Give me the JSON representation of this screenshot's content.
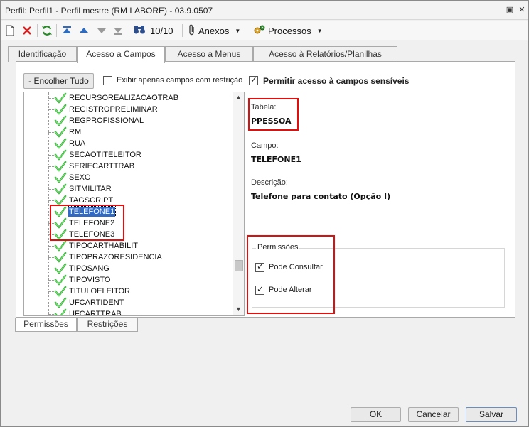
{
  "window": {
    "title": "Perfil: Perfil1 - Perfil mestre (RM LABORE) - 03.9.0507",
    "restore_glyph": "▣",
    "close_glyph": "✕"
  },
  "toolbar": {
    "record_counter": "10/10",
    "anexos_label": "Anexos",
    "processos_label": "Processos",
    "icons": [
      "new-doc-icon",
      "delete-icon",
      "refresh-icon",
      "first-record-icon",
      "previous-record-icon",
      "next-record-icon",
      "last-record-icon",
      "binoculars-icon",
      "paperclip-icon",
      "gears-icon"
    ]
  },
  "tabs": [
    {
      "label": "Identificação",
      "active": false
    },
    {
      "label": "Acesso a Campos",
      "active": true
    },
    {
      "label": "Acesso a Menus",
      "active": false
    },
    {
      "label": "Acesso à Relatórios/Planilhas",
      "active": false
    }
  ],
  "panel": {
    "collapse_button": "- Encolher Tudo",
    "only_restricted_label": "Exibir apenas campos com restrição",
    "only_restricted_checked": false,
    "sensitive_label": "Permitir acesso à campos sensíveis",
    "sensitive_checked": true
  },
  "tree": {
    "items": [
      {
        "label": "RECURSOREALIZACAOTRAB",
        "selected": false
      },
      {
        "label": "REGISTROPRELIMINAR",
        "selected": false
      },
      {
        "label": "REGPROFISSIONAL",
        "selected": false
      },
      {
        "label": "RM",
        "selected": false
      },
      {
        "label": "RUA",
        "selected": false
      },
      {
        "label": "SECAOTITELEITOR",
        "selected": false
      },
      {
        "label": "SERIECARTTRAB",
        "selected": false
      },
      {
        "label": "SEXO",
        "selected": false
      },
      {
        "label": "SITMILITAR",
        "selected": false
      },
      {
        "label": "TAGSCRIPT",
        "selected": false
      },
      {
        "label": "TELEFONE1",
        "selected": true
      },
      {
        "label": "TELEFONE2",
        "selected": false
      },
      {
        "label": "TELEFONE3",
        "selected": false
      },
      {
        "label": "TIPOCARTHABILIT",
        "selected": false
      },
      {
        "label": "TIPOPRAZORESIDENCIA",
        "selected": false
      },
      {
        "label": "TIPOSANG",
        "selected": false
      },
      {
        "label": "TIPOVISTO",
        "selected": false
      },
      {
        "label": "TITULOELEITOR",
        "selected": false
      },
      {
        "label": "UFCARTIDENT",
        "selected": false
      },
      {
        "label": "UFCARTTRAB",
        "selected": false
      }
    ],
    "scroll_up_glyph": "▲",
    "scroll_down_glyph": "▼"
  },
  "details": {
    "tabela_label": "Tabela:",
    "tabela_value": "PPESSOA",
    "campo_label": "Campo:",
    "campo_value": "TELEFONE1",
    "descricao_label": "Descrição:",
    "descricao_value": "Telefone para contato (Opção I)"
  },
  "permissoes": {
    "title": "Permissões",
    "consultar_label": "Pode Consultar",
    "consultar_checked": true,
    "alterar_label": "Pode Alterar",
    "alterar_checked": true
  },
  "bottom_tabs": [
    {
      "label": "Permissões",
      "active": true
    },
    {
      "label": "Restrições",
      "active": false
    }
  ],
  "footer": {
    "ok_label": "OK",
    "cancel_label": "Cancelar",
    "save_label": "Salvar"
  },
  "colors": {
    "highlight_box": "#e10e0e",
    "selection": "#316ac5",
    "check_green": "#2fb52f"
  }
}
